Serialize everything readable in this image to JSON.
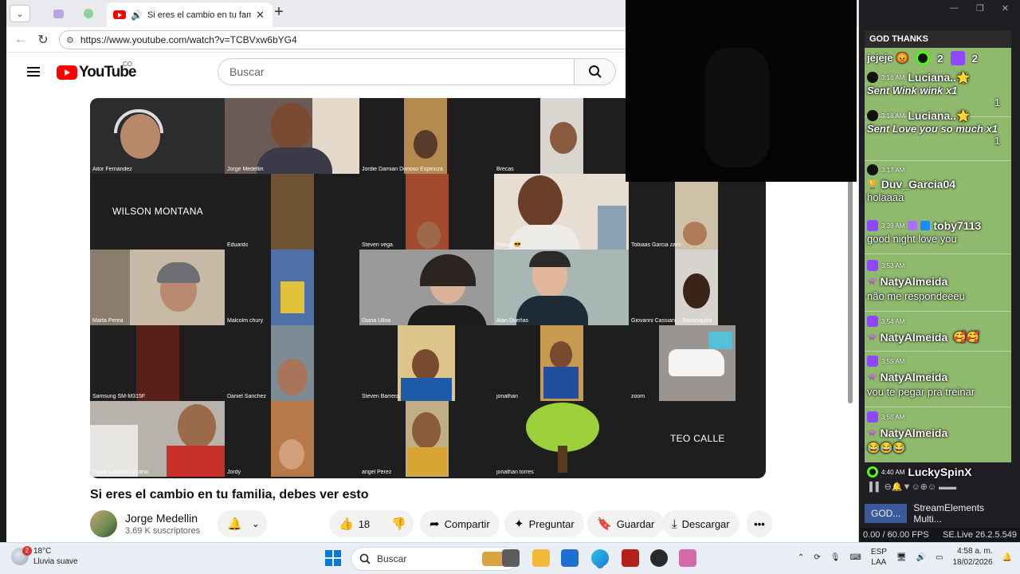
{
  "browser": {
    "active_tab_title": "Si eres el cambio en tu familia",
    "url": "https://www.youtube.com/watch?v=TCBVxw6bYG4"
  },
  "youtube": {
    "logo_text": "YouTube",
    "country_code": "CO",
    "search_placeholder": "Buscar",
    "video_title": "Si eres el cambio en tu familia, debes ver esto",
    "channel_name": "Jorge Medellin",
    "subscribers": "3.69 K suscriptores",
    "like_count": "18",
    "actions": {
      "share": "Compartir",
      "ask": "Preguntar",
      "save": "Guardar",
      "download": "Descargar"
    },
    "participants": [
      "Aitor Fernández",
      "Jorge Medellin",
      "Jordie Damian Donoso Espinoza",
      "Brecas",
      "WILSON MONTANA",
      "Eduardo",
      "Steven vega",
      "Maicol 😎",
      "Tobiaas Garcia zam",
      "Marta Perea",
      "Malcolm chury",
      "Diana Ulloa",
      "Alan Dueñas",
      "Giovanni Cassiani... Barranquilla",
      "Samsung SM-M315F",
      "Daniel Sanchez",
      "Steven Barrera",
      "jonathan",
      "zoom",
      "David Lizcano Lizcano",
      "Jordy",
      "angel Pérez",
      "jonathan torres",
      "TEO CALLE"
    ]
  },
  "chat": {
    "header": "GOD THANKS",
    "top_line": "jejeje 😡",
    "kick_count": "2",
    "twitch_count": "2",
    "messages": [
      {
        "platform": "tiktok",
        "time": "3:16 AM",
        "user": "Luciana..🌟",
        "text": "Sent Wink wink x1",
        "amount": "1"
      },
      {
        "platform": "tiktok",
        "time": "3:16 AM",
        "user": "Luciana..🌟",
        "text": "Sent Love you so much x1",
        "amount": "1"
      },
      {
        "platform": "tiktok",
        "time": "3:17 AM",
        "user": "Duv_Garcia04",
        "text": "holaaaa"
      },
      {
        "platform": "twitch",
        "time": "3:39 AM",
        "user": "toby7113",
        "text": "good night love you"
      },
      {
        "platform": "twitch",
        "time": "3:53 AM",
        "user": "NatyAlmeida",
        "text": "não me respondeeeu"
      },
      {
        "platform": "twitch",
        "time": "3:54 AM",
        "user": "NatyAlmeida",
        "text": "🥰🥰"
      },
      {
        "platform": "twitch",
        "time": "3:55 AM",
        "user": "NatyAlmeida",
        "text": "vou te pegar pra treinar"
      },
      {
        "platform": "twitch",
        "time": "3:55 AM",
        "user": "NatyAlmeida",
        "text": "😂😂😂"
      },
      {
        "platform": "kick",
        "time": "4:40 AM",
        "user": "LuckySpinX",
        "text": ""
      }
    ]
  },
  "obs": {
    "tab_1": "GOD...",
    "tab_2": "StreamElements Multi...",
    "fps": "0.00 / 60.00 FPS",
    "version": "SE.Live 26.2.5.549"
  },
  "taskbar": {
    "temperature": "18°C",
    "weather": "Lluvia suave",
    "weather_badge": "2",
    "search_label": "Buscar",
    "lang_1": "ESP",
    "lang_2": "LAA",
    "time": "4:58 a. m.",
    "date": "18/02/2026"
  }
}
